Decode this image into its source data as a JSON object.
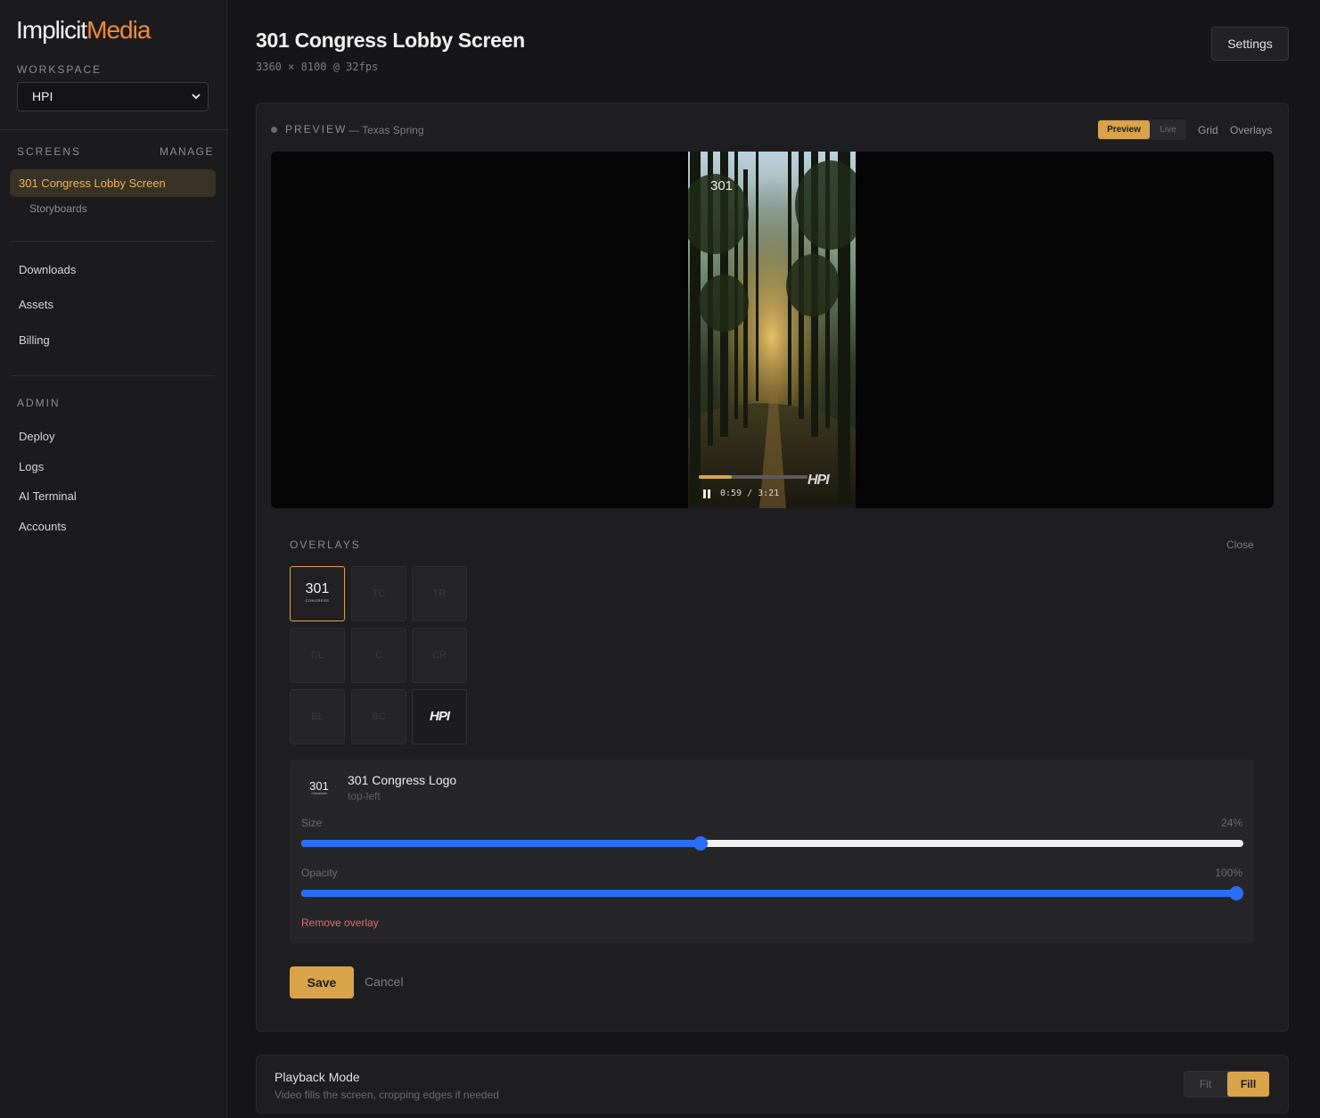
{
  "brand": {
    "name_part1": "Implicit",
    "name_part2": "Media",
    "accent": "#f08a3c"
  },
  "sidebar": {
    "workspace_label": "WORKSPACE",
    "workspace_selected": "HPI",
    "screens_label": "SCREENS",
    "manage_label": "MANAGE",
    "active_screen": "301 Congress Lobby Screen",
    "sub_item": "Storyboards",
    "nav": [
      "Downloads",
      "Assets",
      "Billing"
    ],
    "admin_label": "ADMIN",
    "admin_nav": [
      "Deploy",
      "Logs",
      "AI Terminal",
      "Accounts"
    ]
  },
  "header": {
    "title": "301 Congress Lobby Screen",
    "subtitle": "3360 × 8100 @ 32fps",
    "settings_label": "Settings"
  },
  "preview": {
    "label": "PREVIEW",
    "sub": "— Texas Spring",
    "mode_active": "Preview",
    "mode_inactive": "Live",
    "link_grid": "Grid",
    "link_overlays": "Overlays",
    "progress_fraction": 0.3,
    "time": "0:59 / 3:21",
    "video_logo_tl": "301",
    "video_logo_br": "HPI"
  },
  "overlays": {
    "label": "OVERLAYS",
    "close_label": "Close",
    "cells": {
      "tl_logo_text": "301",
      "tl_logo_sub": "CONGRESS",
      "tc": "TC",
      "tr": "TR",
      "cl": "CL",
      "c": "C",
      "cr": "CR",
      "bl": "BL",
      "bc": "BC",
      "br_logo": "HPI"
    }
  },
  "detail": {
    "logo_text": "301",
    "logo_sub": "CONGRESS",
    "title": "301 Congress Logo",
    "position": "top-left",
    "size_label": "Size",
    "size_value": "24%",
    "size_fraction": 0.424,
    "opacity_label": "Opacity",
    "opacity_value": "100%",
    "opacity_fraction": 1.0,
    "remove_label": "Remove overlay",
    "slider_color": "#2a6ef5"
  },
  "actions": {
    "save_label": "Save",
    "cancel_label": "Cancel"
  },
  "playback": {
    "title": "Playback Mode",
    "subtitle": "Video fills the screen, cropping edges if needed",
    "opt_fit": "Fit",
    "opt_fill": "Fill"
  },
  "accent": "#d9a34a"
}
